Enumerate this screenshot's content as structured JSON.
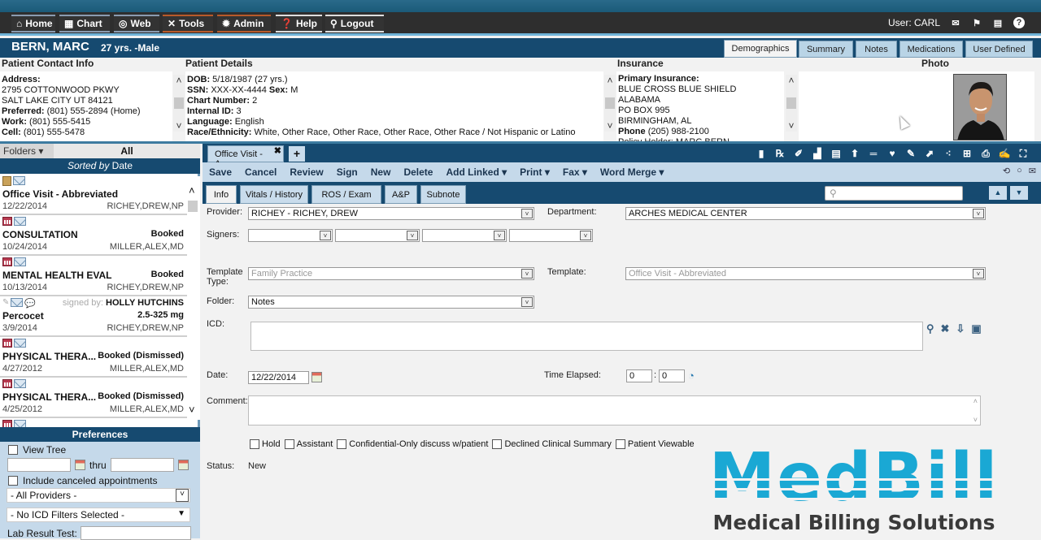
{
  "nav": {
    "items": [
      {
        "label": "Home",
        "icon": "home-icon",
        "glyph": "⌂"
      },
      {
        "label": "Chart",
        "icon": "chart-icon",
        "glyph": "▦"
      },
      {
        "label": "Web",
        "icon": "web-icon",
        "glyph": "◎"
      },
      {
        "label": "Tools",
        "icon": "tools-icon",
        "glyph": "✕"
      },
      {
        "label": "Admin",
        "icon": "admin-icon",
        "glyph": "✹"
      },
      {
        "label": "Help",
        "icon": "help-icon",
        "glyph": "?"
      },
      {
        "label": "Logout",
        "icon": "logout-icon",
        "glyph": "⚲"
      }
    ],
    "user_label": "User: CARL"
  },
  "patient": {
    "name": "BERN, MARC",
    "age_sex": "27 yrs. -Male",
    "tabs": [
      "Demographics",
      "Summary",
      "Notes",
      "Medications",
      "User Defined"
    ],
    "active_tab": "Demographics"
  },
  "contact": {
    "heading": "Patient Contact Info",
    "address_label": "Address:",
    "address_line1": "2795 COTTONWOOD PKWY",
    "address_line2": "SALT LAKE CITY UT 84121",
    "preferred_label": "Preferred:",
    "preferred": "(801) 555-2894 (Home)",
    "work_label": "Work:",
    "work": "(801) 555-5415",
    "cell_label": "Cell:",
    "cell": "(801) 555-5478"
  },
  "details": {
    "heading": "Patient Details",
    "dob_label": "DOB:",
    "dob": "5/18/1987 (27 yrs.)",
    "ssn_label": "SSN:",
    "ssn": "XXX-XX-4444",
    "sex_label": "Sex:",
    "sex": "M",
    "chart_label": "Chart Number:",
    "chart": "2",
    "internal_label": "Internal ID:",
    "internal": "3",
    "language_label": "Language:",
    "language": "English",
    "race_label": "Race/Ethnicity:",
    "race": "White, Other Race, Other Race, Other Race, Other Race / Not Hispanic or Latino"
  },
  "insurance": {
    "heading": "Insurance",
    "primary_label": "Primary Insurance:",
    "line1": "BLUE CROSS BLUE SHIELD",
    "line2": "ALABAMA",
    "line3": "PO BOX 995",
    "line4": "BIRMINGHAM, AL",
    "phone_label": "Phone",
    "phone": "(205) 988-2100",
    "policy_partial": "Policy Holder: MARC BERN"
  },
  "photo": {
    "heading": "Photo"
  },
  "sidebar": {
    "folders_label": "Folders",
    "all_label": "All",
    "sorted_prefix": "Sorted by",
    "sorted_by": "Date",
    "items": [
      {
        "title": "Office Visit - Abbreviated",
        "status": "",
        "date": "12/22/2014",
        "provider": "RICHEY,DREW,NP",
        "type": "note"
      },
      {
        "title": "CONSULTATION",
        "status": "Booked",
        "date": "10/24/2014",
        "provider": "MILLER,ALEX,MD",
        "type": "appt"
      },
      {
        "title": "MENTAL HEALTH EVAL",
        "status": "Booked",
        "date": "10/13/2014",
        "provider": "RICHEY,DREW,NP",
        "type": "appt"
      },
      {
        "title": "Percocet",
        "status": "2.5-325 mg",
        "date": "3/9/2014",
        "provider": "RICHEY,DREW,NP",
        "type": "rx",
        "signed_prefix": "signed by:",
        "signed_by": "HOLLY HUTCHINS"
      },
      {
        "title": "PHYSICAL THERA...",
        "status": "Booked (Dismissed)",
        "date": "4/27/2012",
        "provider": "MILLER,ALEX,MD",
        "type": "appt"
      },
      {
        "title": "PHYSICAL THERA...",
        "status": "Booked (Dismissed)",
        "date": "4/25/2012",
        "provider": "MILLER,ALEX,MD",
        "type": "appt"
      }
    ]
  },
  "preferences": {
    "heading": "Preferences",
    "view_tree": "View Tree",
    "thru": "thru",
    "include_canceled": "Include canceled appointments",
    "providers": "- All Providers -",
    "icd_filter": "- No ICD Filters Selected -",
    "lab_result_label": "Lab Result Test:"
  },
  "document": {
    "tab_label": "Office Visit - A...",
    "add_tab": "+",
    "toolbar_icons": [
      "clipboard-icon",
      "rx-icon",
      "pen-icon",
      "bar-chart-icon",
      "document-icon",
      "upload-icon",
      "bed-icon",
      "heart-icon",
      "syringe-icon",
      "edit-icon",
      "scatter-icon",
      "medkit-icon",
      "printer-icon",
      "sign-icon",
      "fullscreen-icon"
    ],
    "actions": [
      "Save",
      "Cancel",
      "Review",
      "Sign",
      "New",
      "Delete",
      "Add Linked ▾",
      "Print ▾",
      "Fax ▾",
      "Word Merge ▾"
    ],
    "subtabs": [
      "Info",
      "Vitals / History",
      "ROS / Exam",
      "A&P",
      "Subnote"
    ],
    "active_subtab": "Info",
    "search_placeholder": ""
  },
  "form": {
    "provider_label": "Provider:",
    "provider": "RICHEY - RICHEY, DREW",
    "department_label": "Department:",
    "department": "ARCHES MEDICAL CENTER",
    "signers_label": "Signers:",
    "template_type_label": "Template Type:",
    "template_type": "Family Practice",
    "template_label": "Template:",
    "template": "Office Visit - Abbreviated",
    "folder_label": "Folder:",
    "folder": "Notes",
    "icd_label": "ICD:",
    "date_label": "Date:",
    "date": "12/22/2014",
    "time_elapsed_label": "Time Elapsed:",
    "time_hours": "0",
    "time_minutes": "0",
    "comment_label": "Comment:",
    "checkboxes": [
      "Hold",
      "Assistant",
      "Confidential-Only discuss w/patient",
      "Declined Clinical Summary",
      "Patient Viewable"
    ],
    "status_label": "Status:",
    "status": "New"
  },
  "watermark": {
    "brand": "MedBill",
    "tagline": "Medical Billing Solutions",
    "color": "#1aa8d4"
  }
}
